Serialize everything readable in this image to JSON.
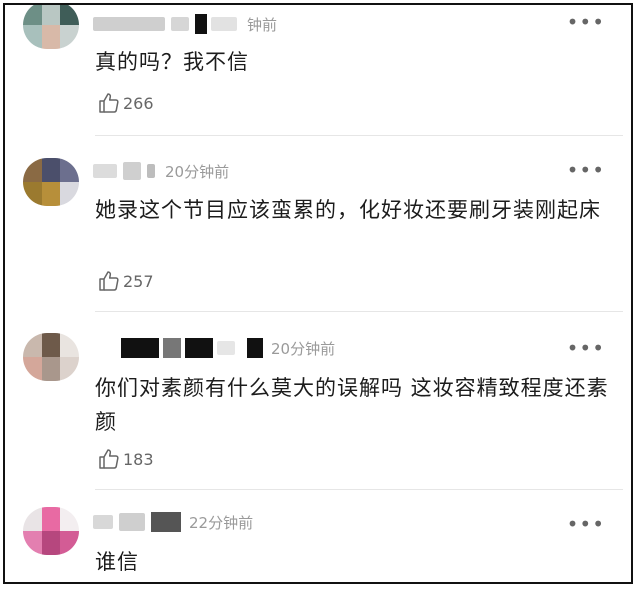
{
  "comments": [
    {
      "time": "钟前",
      "text": "真的吗？我不信",
      "likes": "266"
    },
    {
      "time": "20分钟前",
      "text": "她录这个节目应该蛮累的，化好妆还要刷牙装刚起床",
      "likes": "257"
    },
    {
      "time": "20分钟前",
      "text": "你们对素颜有什么莫大的误解吗  这妆容精致程度还素颜",
      "likes": "183"
    },
    {
      "time": "22分钟前",
      "text": "谁信"
    }
  ],
  "icons": {
    "more": "more-dots-icon",
    "like": "thumbs-up-icon"
  },
  "colors": {
    "time": "#9a9a9a",
    "text": "#1c1c1c",
    "divider": "#e6e6e6"
  }
}
